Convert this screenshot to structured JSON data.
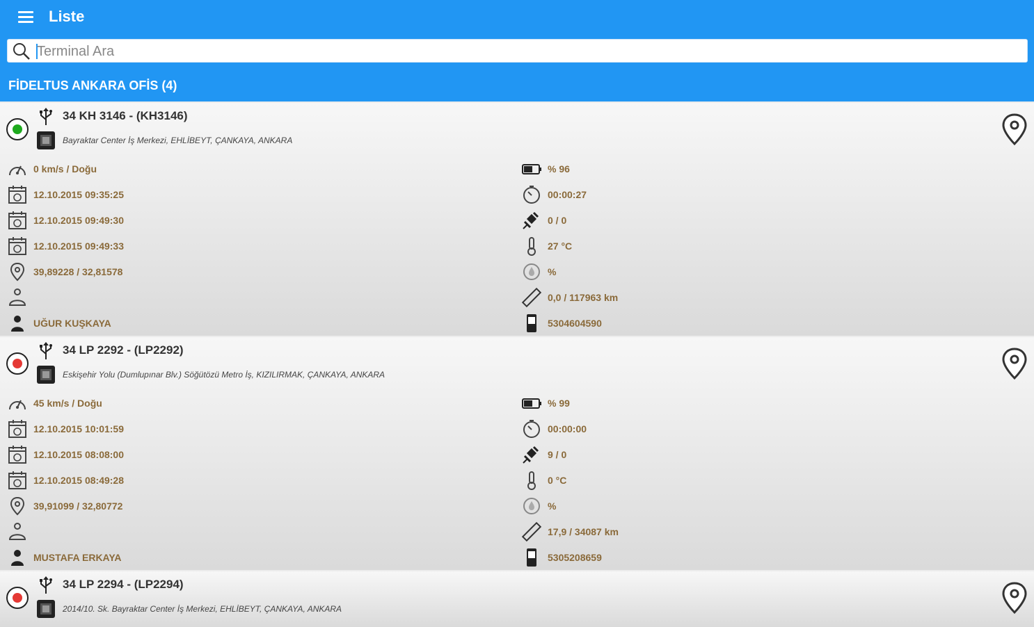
{
  "app": {
    "title": "Liste"
  },
  "search": {
    "placeholder": "Terminal Ara"
  },
  "group": {
    "name": "FİDELTUS ANKARA OFİS (4)"
  },
  "colors": {
    "primary": "#2196f3",
    "status_online": "#1faa1f",
    "status_offline": "#e53935",
    "value_text": "#8a6a3a"
  },
  "vehicles": [
    {
      "plate": "34 KH 3146 - (KH3146)",
      "status": "online",
      "address": "Bayraktar Center İş Merkezi, EHLİBEYT, ÇANKAYA, ANKARA",
      "speed": "0 km/s / Doğu",
      "gps_time": "12.10.2015 09:35:25",
      "event_time": "12.10.2015 09:49:30",
      "server_time": "12.10.2015 09:49:33",
      "coordinates": "39,89228 / 32,81578",
      "driver_label": "",
      "driver": "UĞUR KUŞKAYA",
      "battery": "% 96",
      "duration": "00:00:27",
      "satellite": "0 / 0",
      "temperature": "27 °C",
      "humidity": "%",
      "distance": "0,0 / 117963 km",
      "phone": "5304604590"
    },
    {
      "plate": "34 LP 2292 - (LP2292)",
      "status": "offline",
      "address": "Eskişehir Yolu (Dumlupınar Blv.) Söğütözü Metro İş, KIZILIRMAK, ÇANKAYA, ANKARA",
      "speed": "45 km/s / Doğu",
      "gps_time": "12.10.2015 10:01:59",
      "event_time": "12.10.2015 08:08:00",
      "server_time": "12.10.2015 08:49:28",
      "coordinates": "39,91099 / 32,80772",
      "driver_label": "",
      "driver": "MUSTAFA ERKAYA",
      "battery": "% 99",
      "duration": "00:00:00",
      "satellite": "9 / 0",
      "temperature": "0 °C",
      "humidity": "%",
      "distance": "17,9 / 34087 km",
      "phone": "5305208659"
    },
    {
      "plate": "34 LP 2294 - (LP2294)",
      "status": "offline",
      "address": "2014/10. Sk. Bayraktar Center İş Merkezi, EHLİBEYT, ÇANKAYA, ANKARA"
    }
  ]
}
